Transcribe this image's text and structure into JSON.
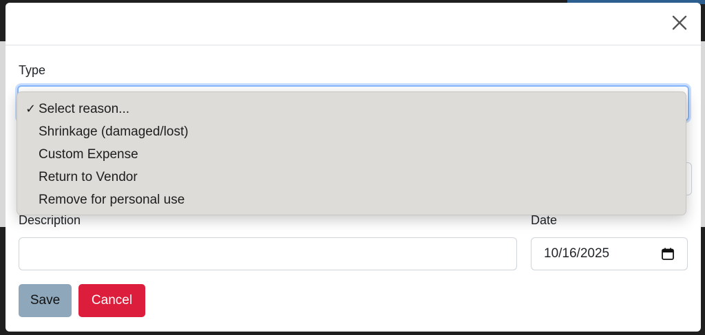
{
  "modal": {
    "close_icon": "close-icon"
  },
  "form": {
    "type_label": "Type",
    "description_label": "Description",
    "description_value": "",
    "date_label": "Date",
    "date_value": "10/16/2025",
    "calendar_icon": "calendar-icon"
  },
  "dropdown": {
    "options": [
      {
        "label": "Select reason...",
        "selected": true,
        "check": "✓"
      },
      {
        "label": "Shrinkage (damaged/lost)",
        "selected": false,
        "check": ""
      },
      {
        "label": "Custom Expense",
        "selected": false,
        "check": ""
      },
      {
        "label": "Return to Vendor",
        "selected": false,
        "check": ""
      },
      {
        "label": "Remove for personal use",
        "selected": false,
        "check": ""
      }
    ]
  },
  "buttons": {
    "save_label": "Save",
    "cancel_label": "Cancel"
  },
  "colors": {
    "save_bg": "#8fa7bb",
    "cancel_bg": "#dc1d3b",
    "focus_border": "#86b7fe"
  }
}
